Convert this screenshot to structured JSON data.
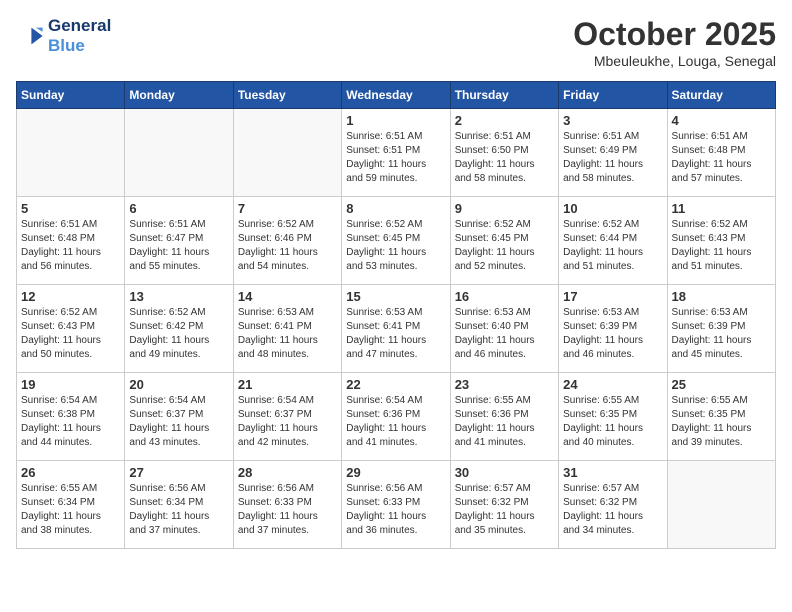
{
  "header": {
    "logo_line1": "General",
    "logo_line2": "Blue",
    "month": "October 2025",
    "location": "Mbeuleukhe, Louga, Senegal"
  },
  "weekdays": [
    "Sunday",
    "Monday",
    "Tuesday",
    "Wednesday",
    "Thursday",
    "Friday",
    "Saturday"
  ],
  "weeks": [
    [
      {
        "day": "",
        "info": ""
      },
      {
        "day": "",
        "info": ""
      },
      {
        "day": "",
        "info": ""
      },
      {
        "day": "1",
        "info": "Sunrise: 6:51 AM\nSunset: 6:51 PM\nDaylight: 11 hours\nand 59 minutes."
      },
      {
        "day": "2",
        "info": "Sunrise: 6:51 AM\nSunset: 6:50 PM\nDaylight: 11 hours\nand 58 minutes."
      },
      {
        "day": "3",
        "info": "Sunrise: 6:51 AM\nSunset: 6:49 PM\nDaylight: 11 hours\nand 58 minutes."
      },
      {
        "day": "4",
        "info": "Sunrise: 6:51 AM\nSunset: 6:48 PM\nDaylight: 11 hours\nand 57 minutes."
      }
    ],
    [
      {
        "day": "5",
        "info": "Sunrise: 6:51 AM\nSunset: 6:48 PM\nDaylight: 11 hours\nand 56 minutes."
      },
      {
        "day": "6",
        "info": "Sunrise: 6:51 AM\nSunset: 6:47 PM\nDaylight: 11 hours\nand 55 minutes."
      },
      {
        "day": "7",
        "info": "Sunrise: 6:52 AM\nSunset: 6:46 PM\nDaylight: 11 hours\nand 54 minutes."
      },
      {
        "day": "8",
        "info": "Sunrise: 6:52 AM\nSunset: 6:45 PM\nDaylight: 11 hours\nand 53 minutes."
      },
      {
        "day": "9",
        "info": "Sunrise: 6:52 AM\nSunset: 6:45 PM\nDaylight: 11 hours\nand 52 minutes."
      },
      {
        "day": "10",
        "info": "Sunrise: 6:52 AM\nSunset: 6:44 PM\nDaylight: 11 hours\nand 51 minutes."
      },
      {
        "day": "11",
        "info": "Sunrise: 6:52 AM\nSunset: 6:43 PM\nDaylight: 11 hours\nand 51 minutes."
      }
    ],
    [
      {
        "day": "12",
        "info": "Sunrise: 6:52 AM\nSunset: 6:43 PM\nDaylight: 11 hours\nand 50 minutes."
      },
      {
        "day": "13",
        "info": "Sunrise: 6:52 AM\nSunset: 6:42 PM\nDaylight: 11 hours\nand 49 minutes."
      },
      {
        "day": "14",
        "info": "Sunrise: 6:53 AM\nSunset: 6:41 PM\nDaylight: 11 hours\nand 48 minutes."
      },
      {
        "day": "15",
        "info": "Sunrise: 6:53 AM\nSunset: 6:41 PM\nDaylight: 11 hours\nand 47 minutes."
      },
      {
        "day": "16",
        "info": "Sunrise: 6:53 AM\nSunset: 6:40 PM\nDaylight: 11 hours\nand 46 minutes."
      },
      {
        "day": "17",
        "info": "Sunrise: 6:53 AM\nSunset: 6:39 PM\nDaylight: 11 hours\nand 46 minutes."
      },
      {
        "day": "18",
        "info": "Sunrise: 6:53 AM\nSunset: 6:39 PM\nDaylight: 11 hours\nand 45 minutes."
      }
    ],
    [
      {
        "day": "19",
        "info": "Sunrise: 6:54 AM\nSunset: 6:38 PM\nDaylight: 11 hours\nand 44 minutes."
      },
      {
        "day": "20",
        "info": "Sunrise: 6:54 AM\nSunset: 6:37 PM\nDaylight: 11 hours\nand 43 minutes."
      },
      {
        "day": "21",
        "info": "Sunrise: 6:54 AM\nSunset: 6:37 PM\nDaylight: 11 hours\nand 42 minutes."
      },
      {
        "day": "22",
        "info": "Sunrise: 6:54 AM\nSunset: 6:36 PM\nDaylight: 11 hours\nand 41 minutes."
      },
      {
        "day": "23",
        "info": "Sunrise: 6:55 AM\nSunset: 6:36 PM\nDaylight: 11 hours\nand 41 minutes."
      },
      {
        "day": "24",
        "info": "Sunrise: 6:55 AM\nSunset: 6:35 PM\nDaylight: 11 hours\nand 40 minutes."
      },
      {
        "day": "25",
        "info": "Sunrise: 6:55 AM\nSunset: 6:35 PM\nDaylight: 11 hours\nand 39 minutes."
      }
    ],
    [
      {
        "day": "26",
        "info": "Sunrise: 6:55 AM\nSunset: 6:34 PM\nDaylight: 11 hours\nand 38 minutes."
      },
      {
        "day": "27",
        "info": "Sunrise: 6:56 AM\nSunset: 6:34 PM\nDaylight: 11 hours\nand 37 minutes."
      },
      {
        "day": "28",
        "info": "Sunrise: 6:56 AM\nSunset: 6:33 PM\nDaylight: 11 hours\nand 37 minutes."
      },
      {
        "day": "29",
        "info": "Sunrise: 6:56 AM\nSunset: 6:33 PM\nDaylight: 11 hours\nand 36 minutes."
      },
      {
        "day": "30",
        "info": "Sunrise: 6:57 AM\nSunset: 6:32 PM\nDaylight: 11 hours\nand 35 minutes."
      },
      {
        "day": "31",
        "info": "Sunrise: 6:57 AM\nSunset: 6:32 PM\nDaylight: 11 hours\nand 34 minutes."
      },
      {
        "day": "",
        "info": ""
      }
    ]
  ]
}
